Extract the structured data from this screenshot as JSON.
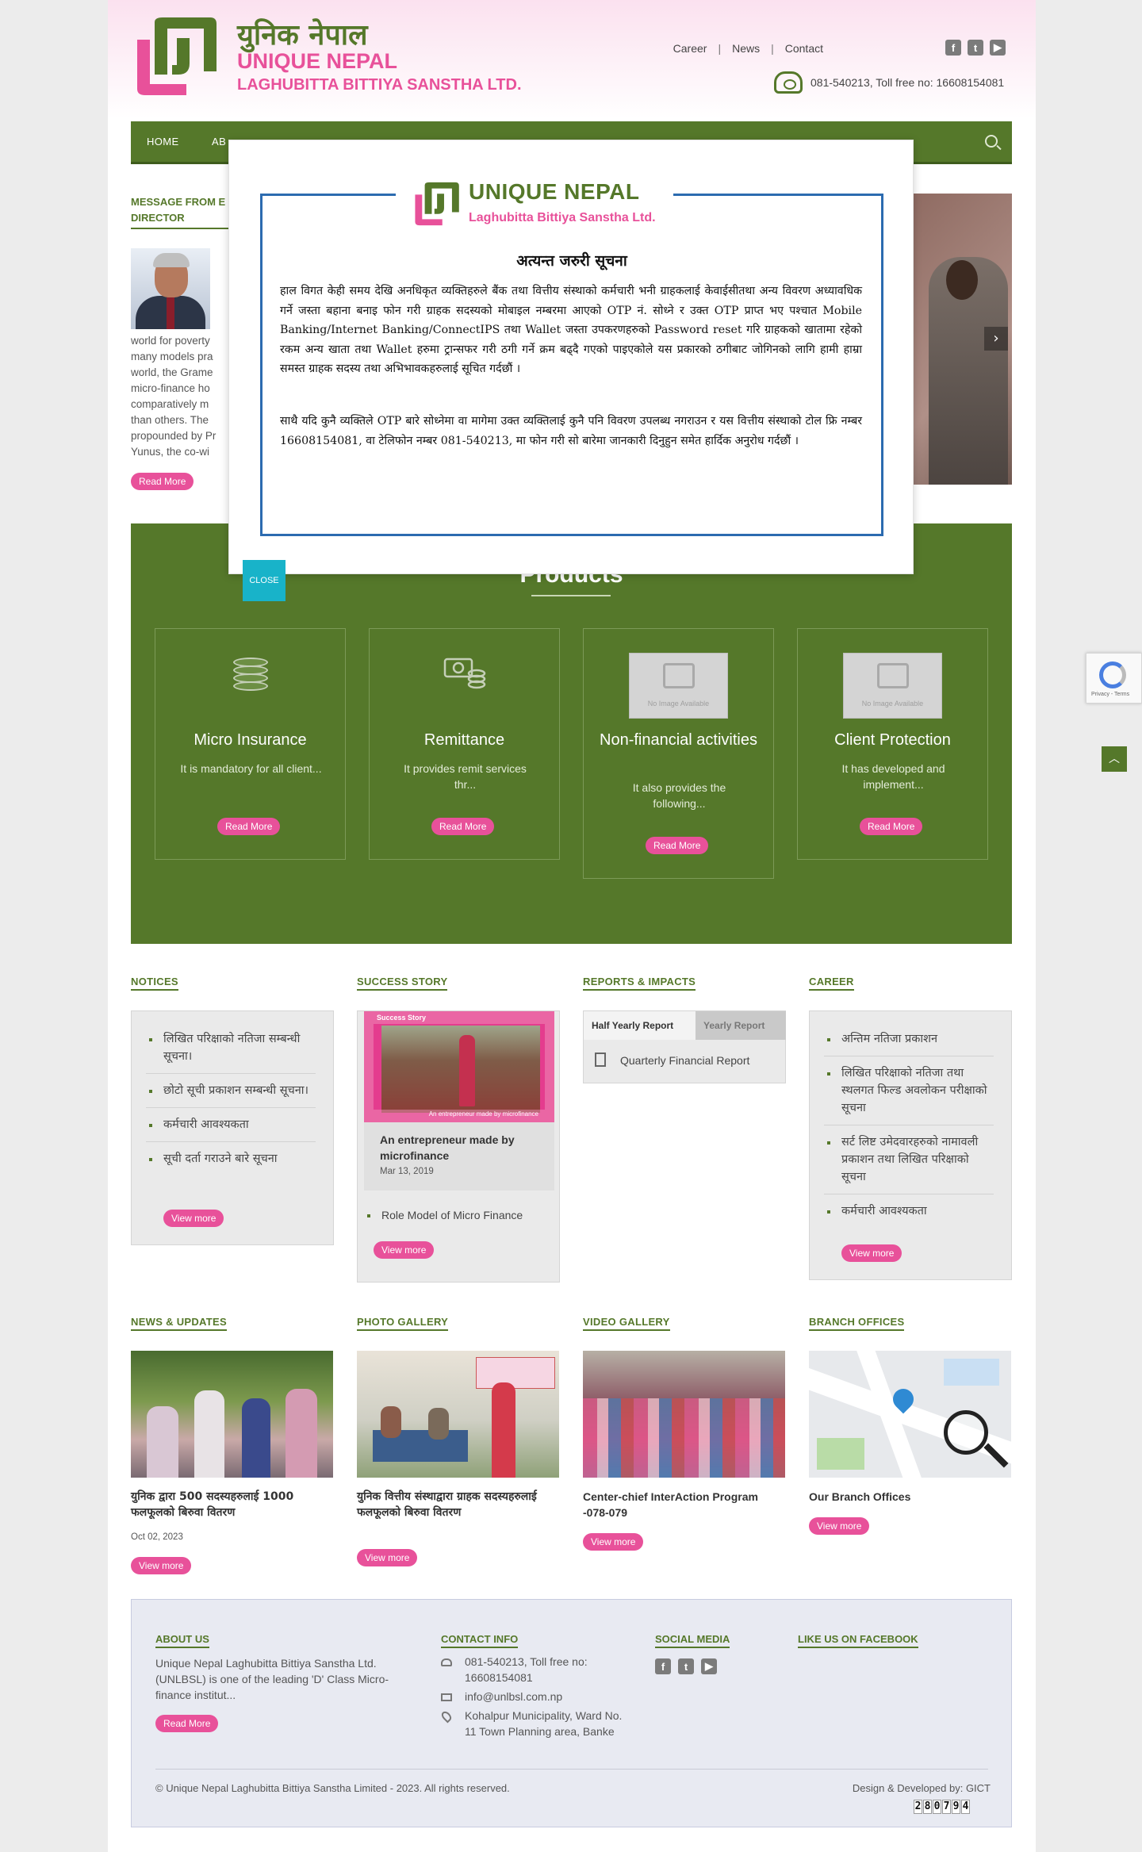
{
  "brand": {
    "name_nepali": "युनिक नेपाल",
    "name_line1": "UNIQUE NEPAL",
    "name_line2": "LAGHUBITTA BITTIYA SANSTHA LTD.",
    "colors": {
      "green": "#55782a",
      "pink": "#e8519a",
      "teal": "#18b3c9"
    }
  },
  "top_links": [
    "Career",
    "News",
    "Contact"
  ],
  "top_social_icons": [
    "facebook-icon",
    "twitter-icon",
    "youtube-icon"
  ],
  "top_contact": "081-540213, Toll free no: 16608154081",
  "nav": {
    "items": [
      "HOME",
      "AB"
    ]
  },
  "message": {
    "title": "MESSAGE FROM E",
    "title_line2": "DIRECTOR",
    "text_lines": [
      "world for poverty",
      "many models pra",
      "world, the Grame",
      "micro-finance ho",
      "comparatively m",
      "than others. The",
      "propounded by Pr",
      "Yunus, the co-wi"
    ],
    "read_more": "Read More"
  },
  "products": {
    "title": "Products",
    "items": [
      {
        "title": "Micro Insurance",
        "desc": "It is mandatory for all client...",
        "button": "Read More",
        "icon": "coins-icon"
      },
      {
        "title": "Remittance",
        "desc": "It provides remit services thr...",
        "button": "Read More",
        "icon": "money-icon"
      },
      {
        "title": "Non-financial activities",
        "desc": "It also provides the following...",
        "button": "Read More",
        "icon": "no-image-icon",
        "noimg": "No Image Available"
      },
      {
        "title": "Client Protection",
        "desc": "It has developed and implement...",
        "button": "Read More",
        "icon": "no-image-icon",
        "noimg": "No Image Available"
      }
    ]
  },
  "notices": {
    "title": "NOTICES",
    "items": [
      "लिखित परिक्षाको नतिजा सम्बन्धी सूचना।",
      "छोटो सूची प्रकाशन सम्बन्धी सूचना।",
      "कर्मचारी आवश्यकता",
      "सूची दर्ता गराउने बारे सूचना"
    ],
    "button": "View more"
  },
  "success_story": {
    "title": "SUCCESS STORY",
    "image_heading": "Success Story",
    "image_caption": "An entrepreneur made by microfinance",
    "headline": "An entrepreneur made by microfinance",
    "date": "Mar 13, 2019",
    "items": [
      "Role Model of Micro Finance"
    ],
    "button": "View more"
  },
  "reports": {
    "title": "REPORTS & IMPACTS",
    "tabs": [
      "Half Yearly Report",
      "Yearly Report"
    ],
    "items": [
      "Quarterly Financial Report"
    ]
  },
  "career": {
    "title": "CAREER",
    "items": [
      "अन्तिम नतिजा प्रकाशन",
      "लिखित परिक्षाको नतिजा तथा स्थलगत फिल्ड अवलोकन परीक्षाको सूचना",
      "सर्ट लिष्ट उमेदवारहरुको नामावली प्रकाशन तथा लिखित परिक्षाको सूचना",
      "कर्मचारी आवश्यकता"
    ],
    "button": "View more"
  },
  "news": {
    "title": "NEWS & UPDATES",
    "headline": "युनिक द्वारा 500 सदस्यहरुलाई 1000 फलफूलको बिरुवा वितरण",
    "date": "Oct 02, 2023",
    "button": "View more"
  },
  "gallery": {
    "title": "PHOTO GALLERY",
    "headline": "युनिक वित्तीय संस्थाद्वारा ग्राहक सदस्यहरुलाई फलफूलको बिरुवा वितरण",
    "button": "View more"
  },
  "video": {
    "title": "VIDEO GALLERY",
    "headline": "Center-chief InterAction Program -078-079",
    "button": "View more"
  },
  "branches": {
    "title": "BRANCH OFFICES",
    "headline": "Our Branch Offices",
    "button": "View more"
  },
  "footer": {
    "about_title": "ABOUT US",
    "about_text": "Unique Nepal Laghubitta Bittiya Sanstha Ltd. (UNLBSL) is one of the leading 'D' Class Micro-finance institut...",
    "about_button": "Read More",
    "contact_title": "CONTACT INFO",
    "contact_phone": "081-540213, Toll free no: 16608154081",
    "contact_email": "info@unlbsl.com.np",
    "contact_address": "Kohalpur Municipality, Ward No. 11 Town Planning area, Banke",
    "social_title": "SOCIAL MEDIA",
    "facebook_title": "LIKE US ON FACEBOOK",
    "copyright": "© Unique Nepal Laghubitta Bittiya Sanstha Limited - 2023. All rights reserved.",
    "credit": "Design & Developed by: GICT",
    "counter": [
      "2",
      "8",
      "0",
      "7",
      "9",
      "4"
    ]
  },
  "modal": {
    "logo_line1": "UNIQUE NEPAL",
    "logo_line2": "Laghubitta Bittiya Sanstha Ltd.",
    "heading": "अत्यन्त जरुरी सूचना",
    "para1": "हाल विगत केही समय देखि अनधिकृत व्यक्तिहरुले बैंक तथा वित्तीय संस्थाको कर्मचारी भनी ग्राहकलाई केवाईसीतथा अन्य विवरण अध्यावधिक गर्ने जस्ता बहाना बनाइ फोन गरी ग्राहक सदस्यको मोबाइल नम्बरमा आएको OTP नं. सोध्ने र उक्त OTP प्राप्त भए पश्चात Mobile Banking/Internet Banking/ConnectIPS तथा Wallet जस्ता उपकरणहरुको Password reset गरि ग्राहकको खातामा रहेको रकम अन्य खाता तथा Wallet हरुमा ट्रान्सफर गरी ठगी गर्ने क्रम बढ्दै गएको पाइएकोले यस प्रकारको ठगीबाट जोगिनको लागि हामी हाम्रा समस्त ग्राहक सदस्य तथा अभिभावकहरुलाई सूचित गर्दछौं ।",
    "para2": "साथै यदि कुनै व्यक्तिले OTP बारे सोध्नेमा वा मागेमा उक्त व्यक्तिलाई कुनै पनि विवरण उपलब्ध नगराउन र यस वित्तीय संस्थाको टोल फ्रि नम्बर 16608154081, वा टेलिफोन नम्बर 081-540213, मा फोन गरी सो बारेमा जानकारी दिनुहुन समेत हार्दिक अनुरोध गर्दछौं ।",
    "close": "CLOSE"
  },
  "recaptcha": {
    "text": "Privacy - Terms"
  }
}
